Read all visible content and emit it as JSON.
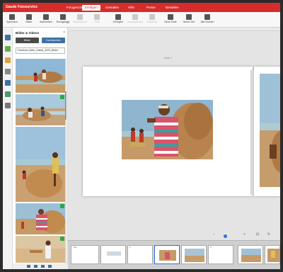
{
  "app": {
    "name": "Gaude Fotoservice",
    "accent": "#d72c2c"
  },
  "menu": [
    {
      "label": "Fotogeschenke",
      "active": false
    },
    {
      "label": "Einfügen",
      "active": true
    },
    {
      "label": "Gestalten",
      "active": false
    },
    {
      "label": "Hilfe",
      "active": false
    },
    {
      "label": "Preise",
      "active": false
    },
    {
      "label": "Bestellen",
      "active": false
    }
  ],
  "toolbar": [
    {
      "label": "Speichern",
      "icon": "save-icon"
    },
    {
      "label": "Bilder",
      "icon": "images-icon"
    },
    {
      "label": "Aufbereiten",
      "icon": "edit-icon"
    },
    {
      "label": "Rückgängig",
      "icon": "undo-icon"
    },
    {
      "label": "Wiederholen",
      "icon": "redo-icon"
    },
    {
      "label": "Text",
      "icon": "text-icon"
    },
    {
      "label": "Einfügen",
      "icon": "paste-icon"
    },
    {
      "label": "Ausschneiden",
      "icon": "cut-icon"
    },
    {
      "label": "Kopieren",
      "icon": "copy-icon"
    },
    {
      "label": "Neue Seite",
      "icon": "new-page-icon"
    },
    {
      "label": "Neues Set",
      "icon": "new-set-icon"
    },
    {
      "label": "Alle löschen",
      "icon": "clear-icon"
    }
  ],
  "panel": {
    "title": "Bilder & Videos",
    "btn_add": "Bilder",
    "btn_browse": "Durchsuchen",
    "folder": "Fotobuch_Mein_Urlaub_2023_Bilder",
    "thumbnails": [
      {
        "name": "thumb-1",
        "used": false
      },
      {
        "name": "thumb-2",
        "used": true
      },
      {
        "name": "thumb-3",
        "used": false
      },
      {
        "name": "thumb-4",
        "used": true
      },
      {
        "name": "thumb-5",
        "used": true
      }
    ]
  },
  "canvas": {
    "left_page_label": "Seite 1",
    "right_page_label": "Seite 2"
  },
  "zoom": {
    "minus": "−",
    "plus": "+"
  },
  "strip": {
    "pages": [
      "Titel",
      "1",
      "2",
      "3",
      "4",
      "5",
      "6",
      "7"
    ]
  }
}
